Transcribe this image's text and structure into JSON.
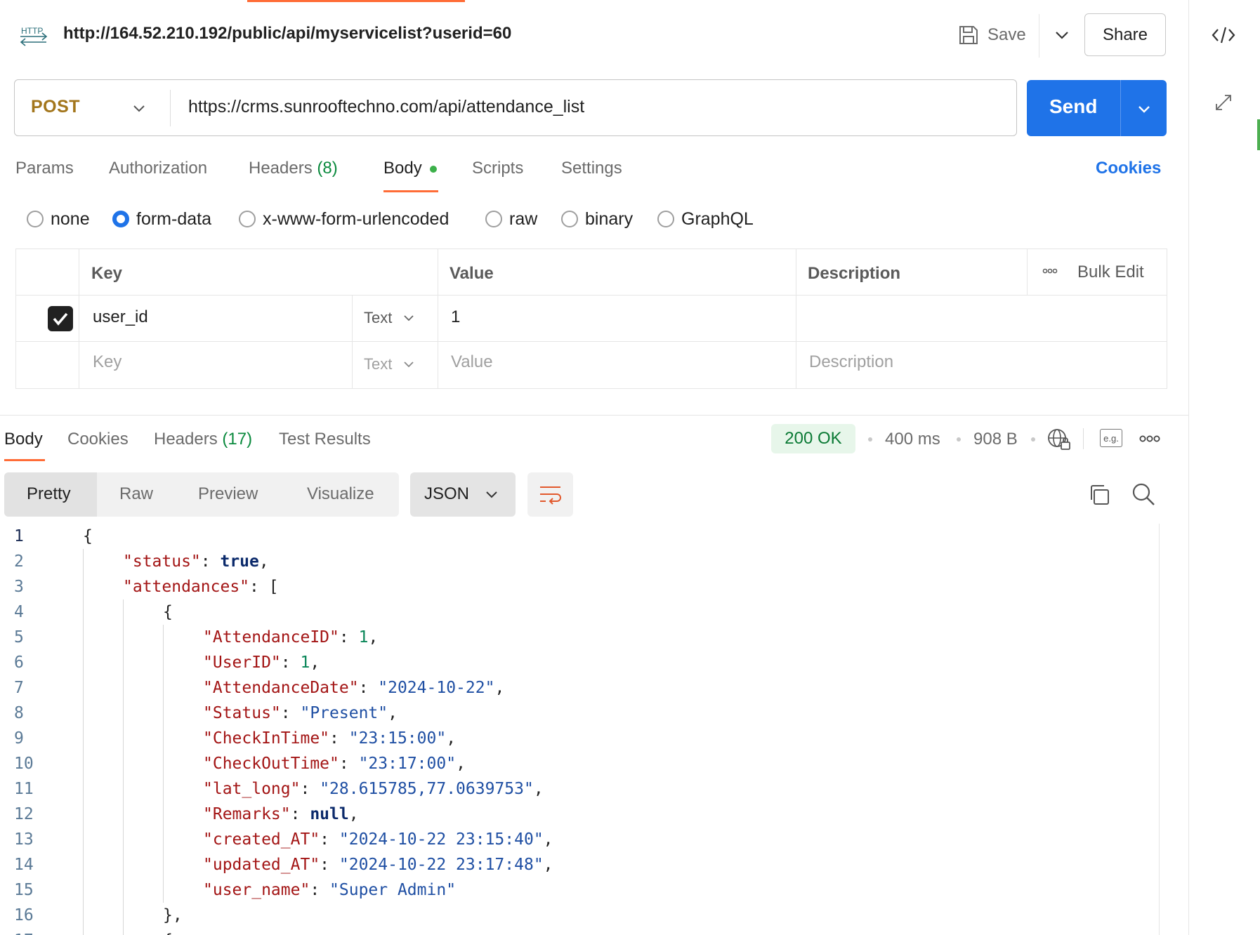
{
  "header": {
    "title": "http://164.52.210.192/public/api/myservicelist?userid=60",
    "http_icon_text": "HTTP",
    "save_label": "Save",
    "share_label": "Share"
  },
  "request": {
    "method": "POST",
    "url": "https://crms.sunrooftechno.com/api/attendance_list",
    "send_label": "Send"
  },
  "request_tabs": {
    "params": "Params",
    "authorization": "Authorization",
    "headers": "Headers",
    "headers_count": "(8)",
    "body": "Body",
    "scripts": "Scripts",
    "settings": "Settings",
    "cookies": "Cookies"
  },
  "body_types": {
    "none": "none",
    "form_data": "form-data",
    "urlencoded": "x-www-form-urlencoded",
    "raw": "raw",
    "binary": "binary",
    "graphql": "GraphQL",
    "selected": "form-data"
  },
  "form_table": {
    "headers": {
      "key": "Key",
      "value": "Value",
      "description": "Description",
      "bulk_edit": "Bulk Edit"
    },
    "rows": [
      {
        "key": "user_id",
        "type": "Text",
        "value": "1",
        "description": ""
      }
    ],
    "placeholder": {
      "key": "Key",
      "type": "Text",
      "value": "Value",
      "description": "Description"
    }
  },
  "response": {
    "tabs": {
      "body": "Body",
      "cookies": "Cookies",
      "headers": "Headers",
      "headers_count": "(17)",
      "test_results": "Test Results"
    },
    "status": "200 OK",
    "time": "400 ms",
    "size": "908 B",
    "example_badge": "e.g.",
    "formats": {
      "pretty": "Pretty",
      "raw": "Raw",
      "preview": "Preview",
      "visualize": "Visualize"
    },
    "language": "JSON",
    "code": [
      {
        "indent": 0,
        "parts": [
          [
            "p",
            "{"
          ]
        ]
      },
      {
        "indent": 1,
        "parts": [
          [
            "k",
            "\"status\""
          ],
          [
            "p",
            ": "
          ],
          [
            "b",
            "true"
          ],
          [
            "p",
            ","
          ]
        ]
      },
      {
        "indent": 1,
        "parts": [
          [
            "k",
            "\"attendances\""
          ],
          [
            "p",
            ": ["
          ]
        ]
      },
      {
        "indent": 2,
        "parts": [
          [
            "p",
            "{"
          ]
        ]
      },
      {
        "indent": 3,
        "parts": [
          [
            "k",
            "\"AttendanceID\""
          ],
          [
            "p",
            ": "
          ],
          [
            "n",
            "1"
          ],
          [
            "p",
            ","
          ]
        ]
      },
      {
        "indent": 3,
        "parts": [
          [
            "k",
            "\"UserID\""
          ],
          [
            "p",
            ": "
          ],
          [
            "n",
            "1"
          ],
          [
            "p",
            ","
          ]
        ]
      },
      {
        "indent": 3,
        "parts": [
          [
            "k",
            "\"AttendanceDate\""
          ],
          [
            "p",
            ": "
          ],
          [
            "s",
            "\"2024-10-22\""
          ],
          [
            "p",
            ","
          ]
        ]
      },
      {
        "indent": 3,
        "parts": [
          [
            "k",
            "\"Status\""
          ],
          [
            "p",
            ": "
          ],
          [
            "s",
            "\"Present\""
          ],
          [
            "p",
            ","
          ]
        ]
      },
      {
        "indent": 3,
        "parts": [
          [
            "k",
            "\"CheckInTime\""
          ],
          [
            "p",
            ": "
          ],
          [
            "s",
            "\"23:15:00\""
          ],
          [
            "p",
            ","
          ]
        ]
      },
      {
        "indent": 3,
        "parts": [
          [
            "k",
            "\"CheckOutTime\""
          ],
          [
            "p",
            ": "
          ],
          [
            "s",
            "\"23:17:00\""
          ],
          [
            "p",
            ","
          ]
        ]
      },
      {
        "indent": 3,
        "parts": [
          [
            "k",
            "\"lat_long\""
          ],
          [
            "p",
            ": "
          ],
          [
            "s",
            "\"28.615785,77.0639753\""
          ],
          [
            "p",
            ","
          ]
        ]
      },
      {
        "indent": 3,
        "parts": [
          [
            "k",
            "\"Remarks\""
          ],
          [
            "p",
            ": "
          ],
          [
            "b",
            "null"
          ],
          [
            "p",
            ","
          ]
        ]
      },
      {
        "indent": 3,
        "parts": [
          [
            "k",
            "\"created_AT\""
          ],
          [
            "p",
            ": "
          ],
          [
            "s",
            "\"2024-10-22 23:15:40\""
          ],
          [
            "p",
            ","
          ]
        ]
      },
      {
        "indent": 3,
        "parts": [
          [
            "k",
            "\"updated_AT\""
          ],
          [
            "p",
            ": "
          ],
          [
            "s",
            "\"2024-10-22 23:17:48\""
          ],
          [
            "p",
            ","
          ]
        ]
      },
      {
        "indent": 3,
        "parts": [
          [
            "k",
            "\"user_name\""
          ],
          [
            "p",
            ": "
          ],
          [
            "s",
            "\"Super Admin\""
          ]
        ]
      },
      {
        "indent": 2,
        "parts": [
          [
            "p",
            "},"
          ]
        ]
      },
      {
        "indent": 2,
        "parts": [
          [
            "p",
            "{"
          ]
        ]
      }
    ]
  },
  "colors": {
    "accent": "#ff6c37",
    "send": "#1f73e8",
    "method": "#a3761c",
    "status_ok": "#0b7a35"
  }
}
